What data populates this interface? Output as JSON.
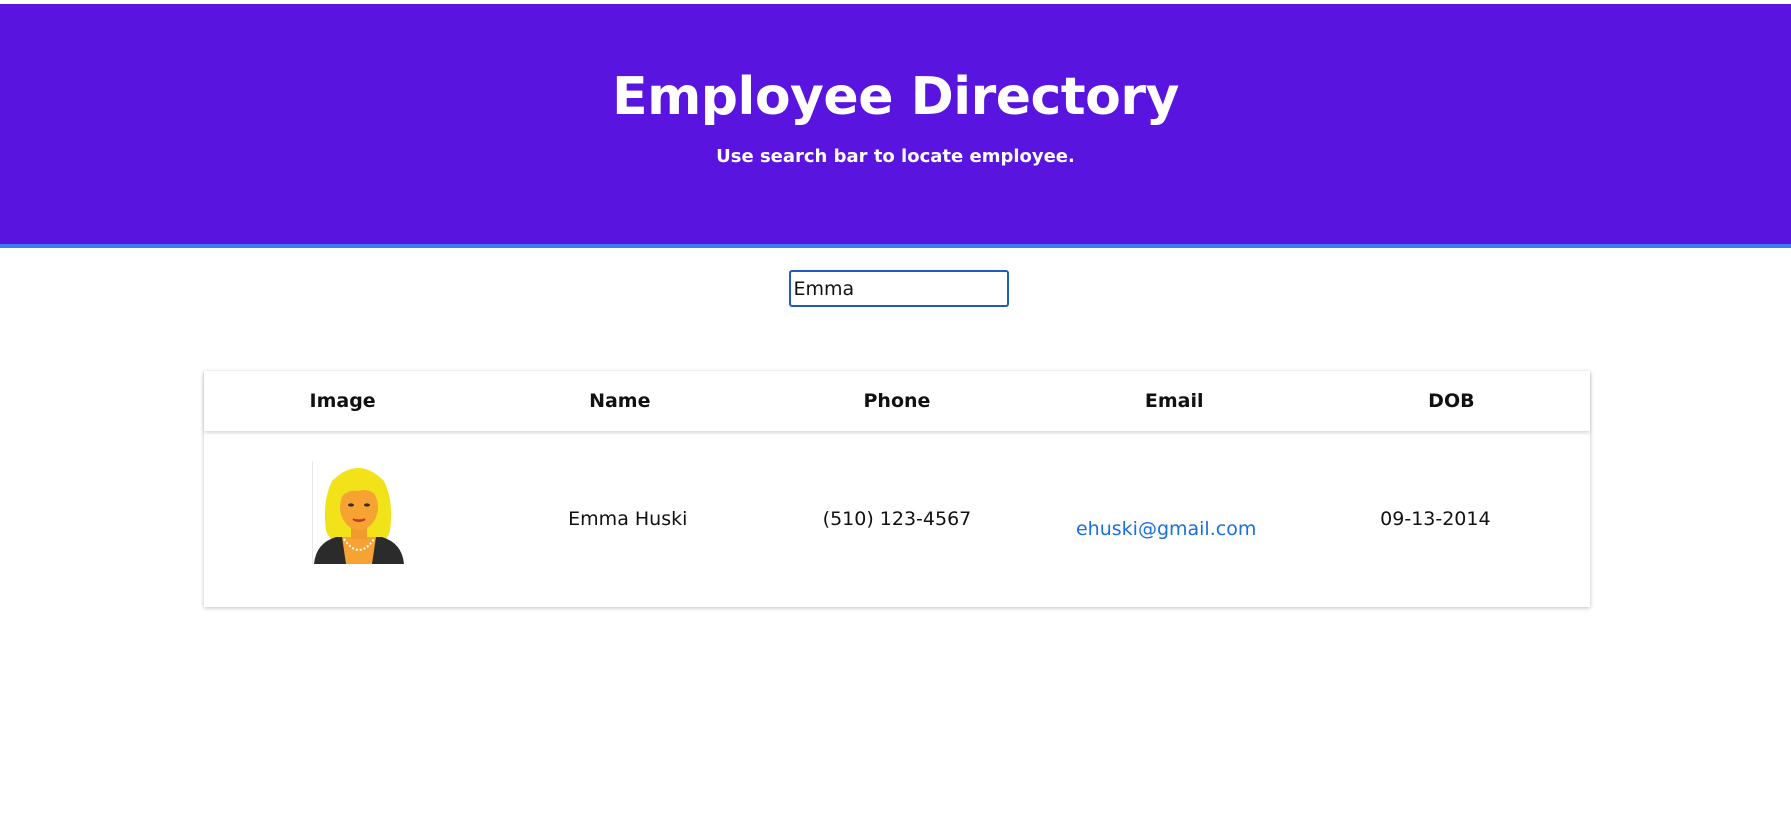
{
  "header": {
    "title": "Employee Directory",
    "subtitle": "Use search bar to locate employee."
  },
  "search": {
    "value": "Emma"
  },
  "table": {
    "columns": [
      "Image",
      "Name",
      "Phone",
      "Email",
      "DOB"
    ],
    "rows": [
      {
        "image": "avatar-woman-blonde",
        "name": "Emma Huski",
        "phone": "(510) 123-4567",
        "email": "ehuski@gmail.com",
        "dob": "09-13-2014"
      }
    ]
  },
  "colors": {
    "header_bg": "#5a14e0",
    "header_border": "#3d7cf0",
    "link": "#1a6fe0"
  }
}
